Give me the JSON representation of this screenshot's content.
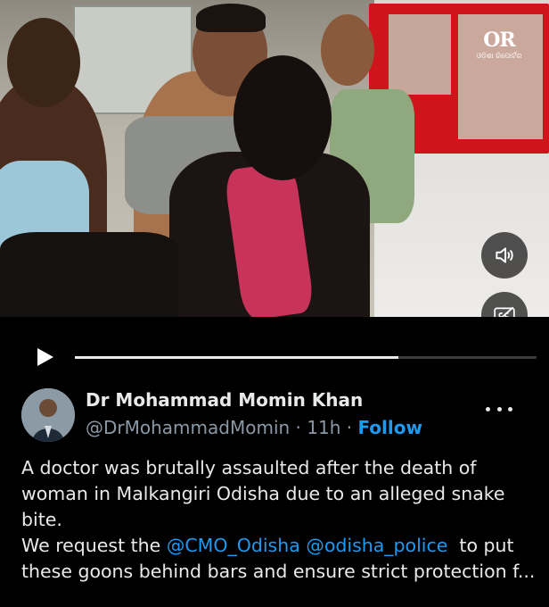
{
  "video": {
    "logo_text": "OR",
    "logo_subtext": "ଓଡ଼ିଶା ରିପୋର୍ଟର",
    "progress": 0.7
  },
  "post": {
    "author_name": "Dr Mohammad Momin Khan",
    "handle": "@DrMohammadMomin",
    "separator": "·",
    "time": "11h",
    "follow_label": "Follow",
    "text_lines": [
      "A doctor was brutally assaulted after the death of",
      "woman in Malkangiri Odisha due to an alleged snake",
      "bite."
    ],
    "line4_prefix": "We request the ",
    "mention_1": "@CMO_Odisha",
    "mention_2": "@odisha_police",
    "line4_suffix": "  to put",
    "line5": "these goons behind bars and ensure strict protection f..."
  },
  "icons": {
    "volume": "speaker-icon",
    "captions": "captions-icon",
    "play": "play-icon",
    "more": "more-icon"
  }
}
